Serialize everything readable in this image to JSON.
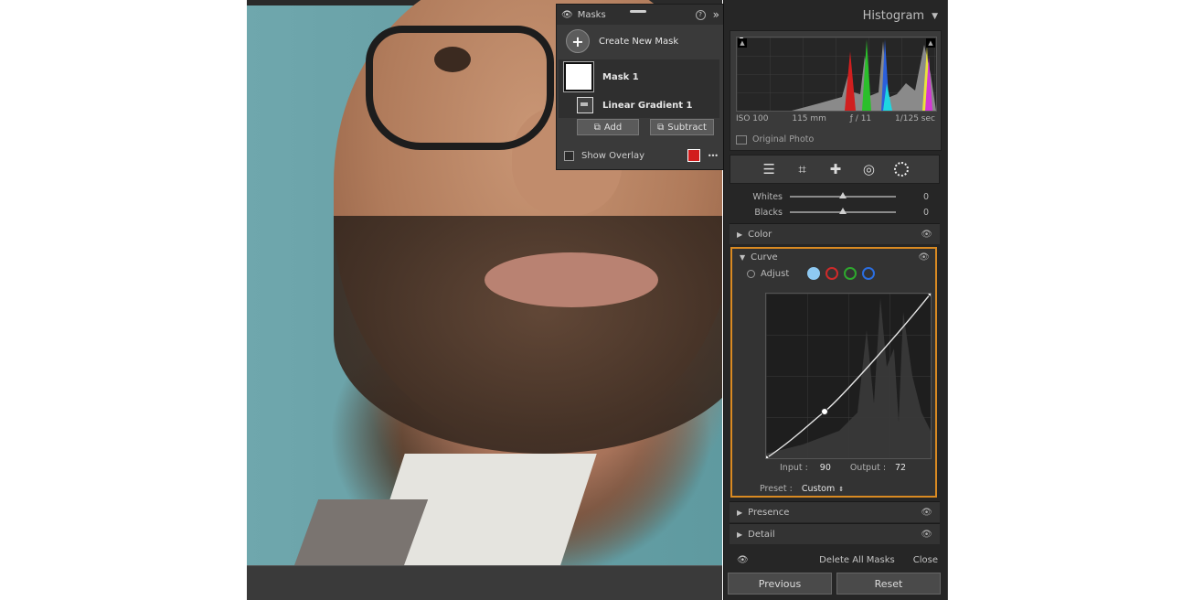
{
  "masks": {
    "title": "Masks",
    "create_label": "Create New Mask",
    "mask1_label": "Mask 1",
    "gradient_label": "Linear Gradient 1",
    "add_label": "Add",
    "subtract_label": "Subtract",
    "show_overlay_label": "Show Overlay",
    "overlay_color": "#d21d1d",
    "help_glyph": "?",
    "collapse_glyph": "»",
    "more_glyph": "•••"
  },
  "histogram": {
    "title": "Histogram",
    "iso": "ISO 100",
    "focal": "115 mm",
    "aperture": "ƒ / 11",
    "shutter": "1/125 sec",
    "original_label": "Original Photo"
  },
  "sliders": [
    {
      "label": "Whites",
      "value": "0",
      "level": 0.5
    },
    {
      "label": "Blacks",
      "value": "0",
      "level": 0.5
    }
  ],
  "sections": {
    "color": "Color",
    "curve": "Curve",
    "presence": "Presence",
    "detail": "Detail"
  },
  "curve": {
    "adjust_label": "Adjust",
    "input_label": "Input :",
    "input_value": "90",
    "output_label": "Output :",
    "output_value": "72",
    "preset_label": "Preset :",
    "preset_value": "Custom"
  },
  "footer": {
    "delete_all": "Delete All Masks",
    "close": "Close",
    "previous": "Previous",
    "reset": "Reset"
  }
}
